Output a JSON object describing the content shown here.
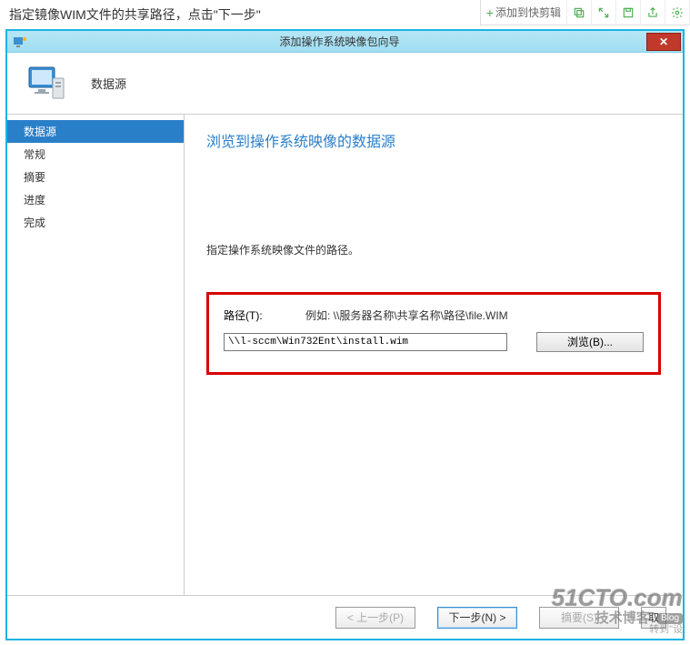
{
  "top_instruction": "指定镜像WIM文件的共享路径，点击\"下一步\"",
  "toolbar": {
    "add_clip_label": "添加到快剪辑"
  },
  "window": {
    "title": "添加操作系统映像包向导",
    "close_glyph": "✕"
  },
  "header": {
    "page_title": "数据源"
  },
  "sidebar": {
    "items": [
      {
        "label": "数据源",
        "active": true
      },
      {
        "label": "常规",
        "active": false
      },
      {
        "label": "摘要",
        "active": false
      },
      {
        "label": "进度",
        "active": false
      },
      {
        "label": "完成",
        "active": false
      }
    ]
  },
  "main": {
    "heading": "浏览到操作系统映像的数据源",
    "instruction": "指定操作系统映像文件的路径。",
    "path_label": "路径(T):",
    "path_example": "例如: \\\\服务器名称\\共享名称\\路径\\file.WIM",
    "path_value": "\\\\l-sccm\\Win732Ent\\install.wim",
    "browse_label": "浏览(B)..."
  },
  "footer": {
    "prev": "< 上一步(P)",
    "next": "下一步(N) >",
    "summary": "摘要(S)",
    "cancel_partial": "取"
  },
  "watermark": {
    "line1": "51CTO.com",
    "line2_main": "技术博客",
    "line2_badge": "Blog",
    "line3": "转到\"设"
  }
}
